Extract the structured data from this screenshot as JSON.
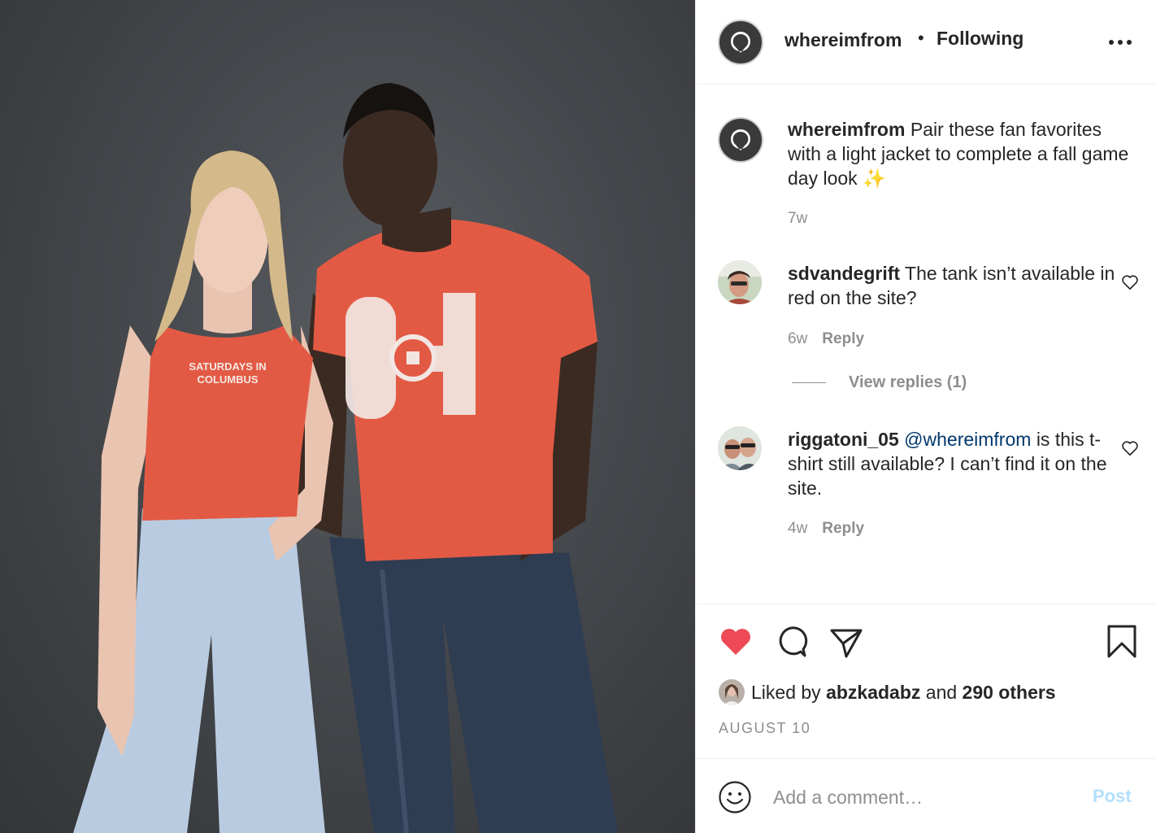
{
  "post": {
    "username": "whereimfrom",
    "separator": "•",
    "follow_status": "Following",
    "photo": {
      "tank_text": "SATURDAYS IN COLUMBUS",
      "shirt_text": "OH"
    },
    "caption": {
      "username": "whereimfrom",
      "text": "Pair these fan favorites with a light jacket to complete a fall game day look",
      "emoji": "✨",
      "age": "7w"
    },
    "comments": [
      {
        "username": "sdvandegrift",
        "text": "The tank isn’t available in red on the site?",
        "age": "6w",
        "reply_label": "Reply",
        "view_replies": "View replies (1)"
      },
      {
        "username": "riggatoni_05",
        "mention": "@whereimfrom",
        "text": "is this t-shirt still available? I can’t find it on the site.",
        "age": "4w",
        "reply_label": "Reply"
      }
    ],
    "likes": {
      "prefix": "Liked by",
      "liker": "abzkadabz",
      "and": "and",
      "others": "290 others"
    },
    "date": "AUGUST 10",
    "add_comment": {
      "placeholder": "Add a comment…",
      "post_label": "Post"
    },
    "colors": {
      "like_red": "#ed4956",
      "post_blue_disabled": "#b2dffc",
      "mention_blue": "#00376b",
      "shirt_red": "#e35a44"
    },
    "icons": [
      "logo-icon",
      "more-icon",
      "heart-outline-icon",
      "heart-filled-icon",
      "comment-icon",
      "share-icon",
      "bookmark-icon",
      "smile-icon"
    ]
  }
}
